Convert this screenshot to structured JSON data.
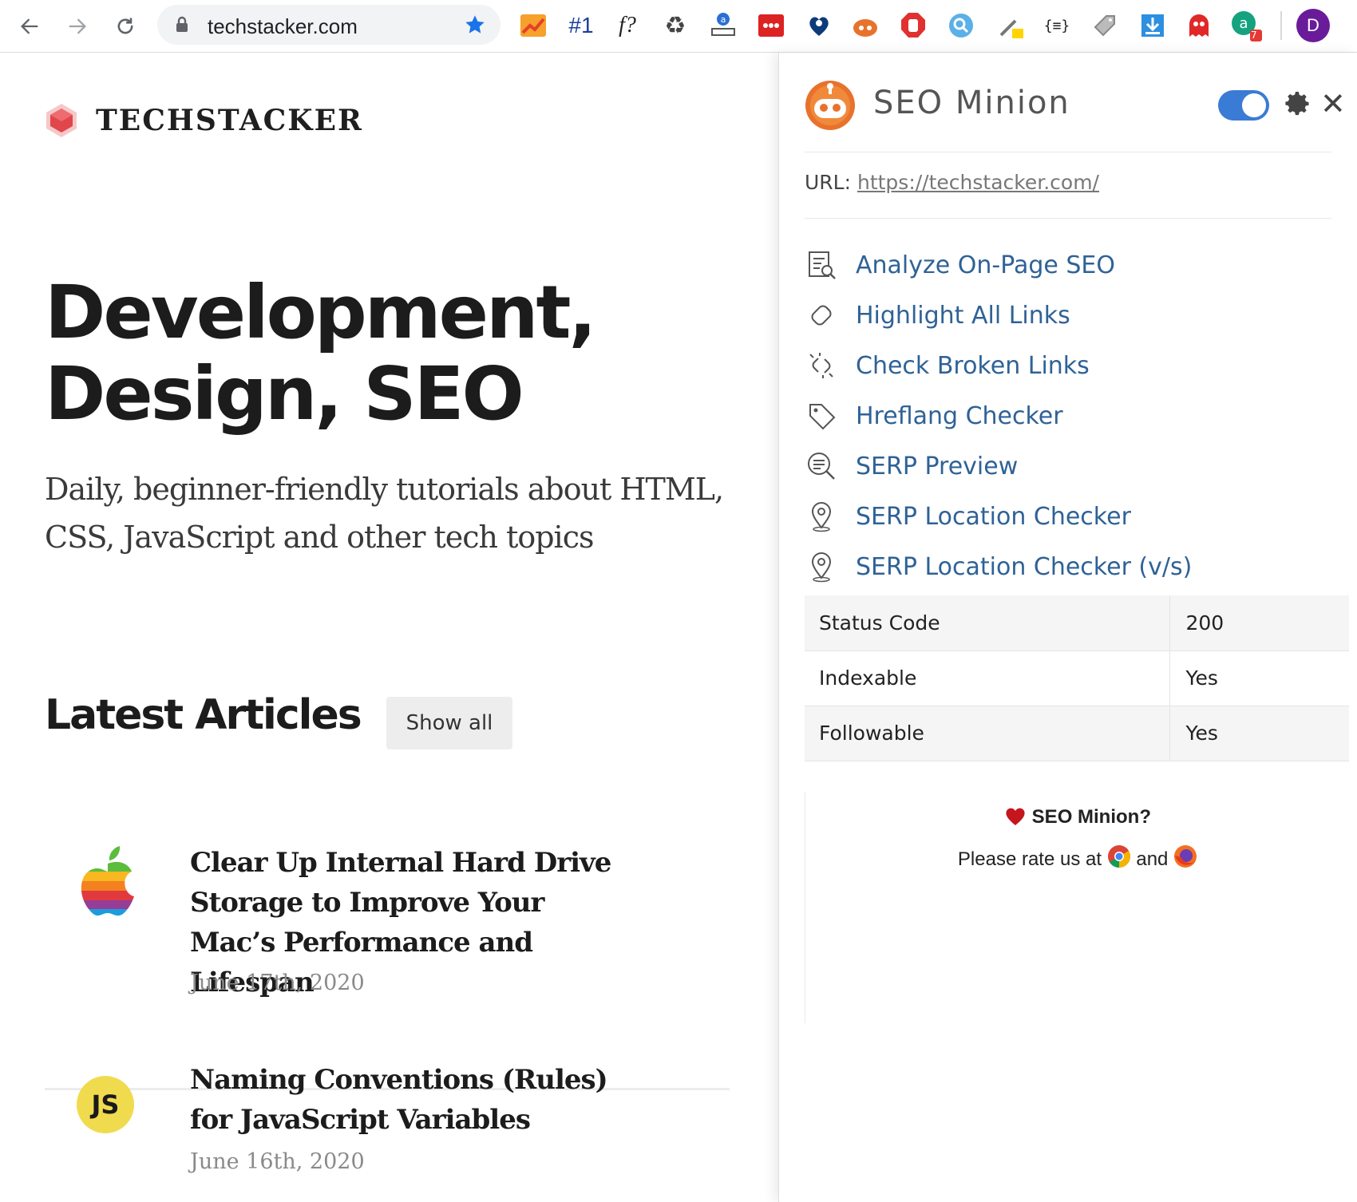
{
  "browser": {
    "url": "techstacker.com",
    "profile_initial": "D",
    "extension_badge": "7",
    "extensions": [
      "trend-icon",
      "rank-one-icon",
      "font-question-icon",
      "recycle-icon",
      "amazon-scale-icon",
      "dots-red-icon",
      "heart-pin-icon",
      "seo-minion-icon",
      "adblock-icon",
      "magnifier-icon",
      "eyedropper-icon",
      "json-icon",
      "tag-icon",
      "download-icon",
      "ghost-icon",
      "grammarly-icon"
    ],
    "ext_labels": {
      "rank": "#1",
      "font": "f?",
      "json": "{≡}"
    }
  },
  "site": {
    "logo_text": "TECHSTACKER",
    "hero_title_line1": "Development,",
    "hero_title_line2": "Design, SEO",
    "hero_subtitle": "Daily, beginner-friendly tutorials about HTML, CSS, JavaScript and other tech topics",
    "latest_heading": "Latest Articles",
    "show_all": "Show all",
    "articles": [
      {
        "title": "Clear Up Internal Hard Drive Storage to Improve Your Mac’s Performance and Lifespan",
        "date": "June 17th, 2020",
        "thumb": "apple-logo-icon"
      },
      {
        "title": "Naming Conventions (Rules) for JavaScript Variables",
        "date": "June 16th, 2020",
        "thumb_text": "JS"
      }
    ]
  },
  "panel": {
    "title": "SEO Minion",
    "url_label": "URL:",
    "url_value": "https://techstacker.com/",
    "menu": [
      {
        "label": "Analyze On-Page SEO",
        "icon": "document-search-icon"
      },
      {
        "label": "Highlight All Links",
        "icon": "link-icon"
      },
      {
        "label": "Check Broken Links",
        "icon": "broken-link-icon"
      },
      {
        "label": "Hreflang Checker",
        "icon": "tag-icon"
      },
      {
        "label": "SERP Preview",
        "icon": "list-search-icon"
      },
      {
        "label": "SERP Location Checker",
        "icon": "map-pin-icon"
      },
      {
        "label": "SERP Location Checker (v/s)",
        "icon": "map-pin-icon"
      }
    ],
    "stats": [
      {
        "key": "Status Code",
        "value": "200"
      },
      {
        "key": "Indexable",
        "value": "Yes"
      },
      {
        "key": "Followable",
        "value": "Yes"
      }
    ],
    "rate_title": "SEO Minion?",
    "rate_prefix": "Please rate us at",
    "rate_and": "and",
    "toggle_on": true
  },
  "colors": {
    "panel_link": "#2f6296",
    "toggle": "#3a7bd5",
    "minion_orange": "#e8722c",
    "logo_red": "#e0464c"
  }
}
